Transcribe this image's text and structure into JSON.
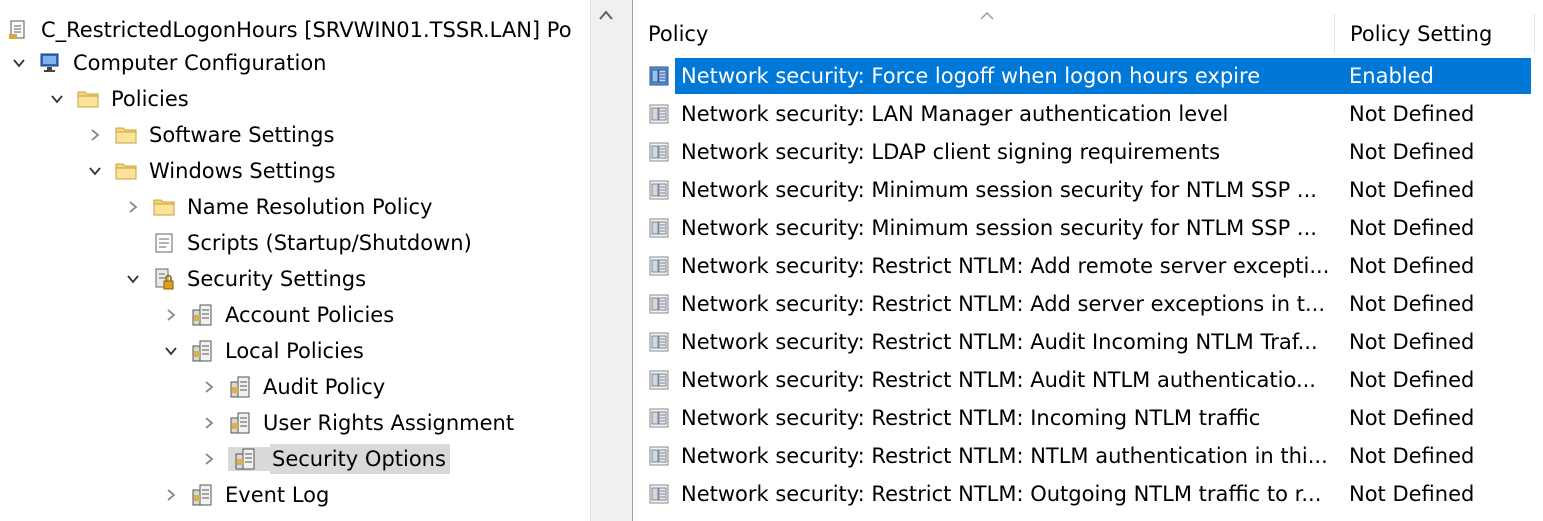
{
  "tree": {
    "root": {
      "label": "C_RestrictedLogonHours [SRVWIN01.TSSR.LAN] Po",
      "icon": "policy-document-icon"
    },
    "nodes": [
      {
        "label": "Computer Configuration",
        "icon": "computer-icon",
        "expander": "expanded"
      },
      {
        "label": "Policies",
        "icon": "folder-icon",
        "expander": "expanded"
      },
      {
        "label": "Software Settings",
        "icon": "folder-icon",
        "expander": "collapsed"
      },
      {
        "label": "Windows Settings",
        "icon": "folder-icon",
        "expander": "expanded"
      },
      {
        "label": "Name Resolution Policy",
        "icon": "folder-icon",
        "expander": "collapsed"
      },
      {
        "label": "Scripts (Startup/Shutdown)",
        "icon": "script-icon",
        "expander": "none"
      },
      {
        "label": "Security Settings",
        "icon": "security-settings-icon",
        "expander": "expanded"
      },
      {
        "label": "Account Policies",
        "icon": "policy-container-icon",
        "expander": "collapsed"
      },
      {
        "label": "Local Policies",
        "icon": "policy-container-icon",
        "expander": "expanded"
      },
      {
        "label": "Audit Policy",
        "icon": "policy-container-icon",
        "expander": "collapsed"
      },
      {
        "label": "User Rights Assignment",
        "icon": "policy-container-icon",
        "expander": "collapsed"
      },
      {
        "label": "Security Options",
        "icon": "policy-container-icon",
        "expander": "collapsed",
        "selected": true
      },
      {
        "label": "Event Log",
        "icon": "policy-container-icon",
        "expander": "collapsed"
      }
    ]
  },
  "list": {
    "columns": {
      "policy": "Policy",
      "setting": "Policy Setting"
    },
    "rows": [
      {
        "policy": "Network security: Force logoff when logon hours expire",
        "setting": "Enabled",
        "selected": true
      },
      {
        "policy": "Network security: LAN Manager authentication level",
        "setting": "Not Defined"
      },
      {
        "policy": "Network security: LDAP client signing requirements",
        "setting": "Not Defined"
      },
      {
        "policy": "Network security: Minimum session security for NTLM SSP ...",
        "setting": "Not Defined"
      },
      {
        "policy": "Network security: Minimum session security for NTLM SSP ...",
        "setting": "Not Defined"
      },
      {
        "policy": "Network security: Restrict NTLM: Add remote server excepti...",
        "setting": "Not Defined"
      },
      {
        "policy": "Network security: Restrict NTLM: Add server exceptions in t...",
        "setting": "Not Defined"
      },
      {
        "policy": "Network security: Restrict NTLM: Audit Incoming NTLM Traf...",
        "setting": "Not Defined"
      },
      {
        "policy": "Network security: Restrict NTLM: Audit NTLM authenticatio...",
        "setting": "Not Defined"
      },
      {
        "policy": "Network security: Restrict NTLM: Incoming NTLM traffic",
        "setting": "Not Defined"
      },
      {
        "policy": "Network security: Restrict NTLM: NTLM authentication in thi...",
        "setting": "Not Defined"
      },
      {
        "policy": "Network security: Restrict NTLM: Outgoing NTLM traffic to r...",
        "setting": "Not Defined"
      }
    ]
  },
  "colors": {
    "selection": "#0078d7",
    "tree_selection": "#d9d9d9",
    "folder": "#f8d775"
  }
}
